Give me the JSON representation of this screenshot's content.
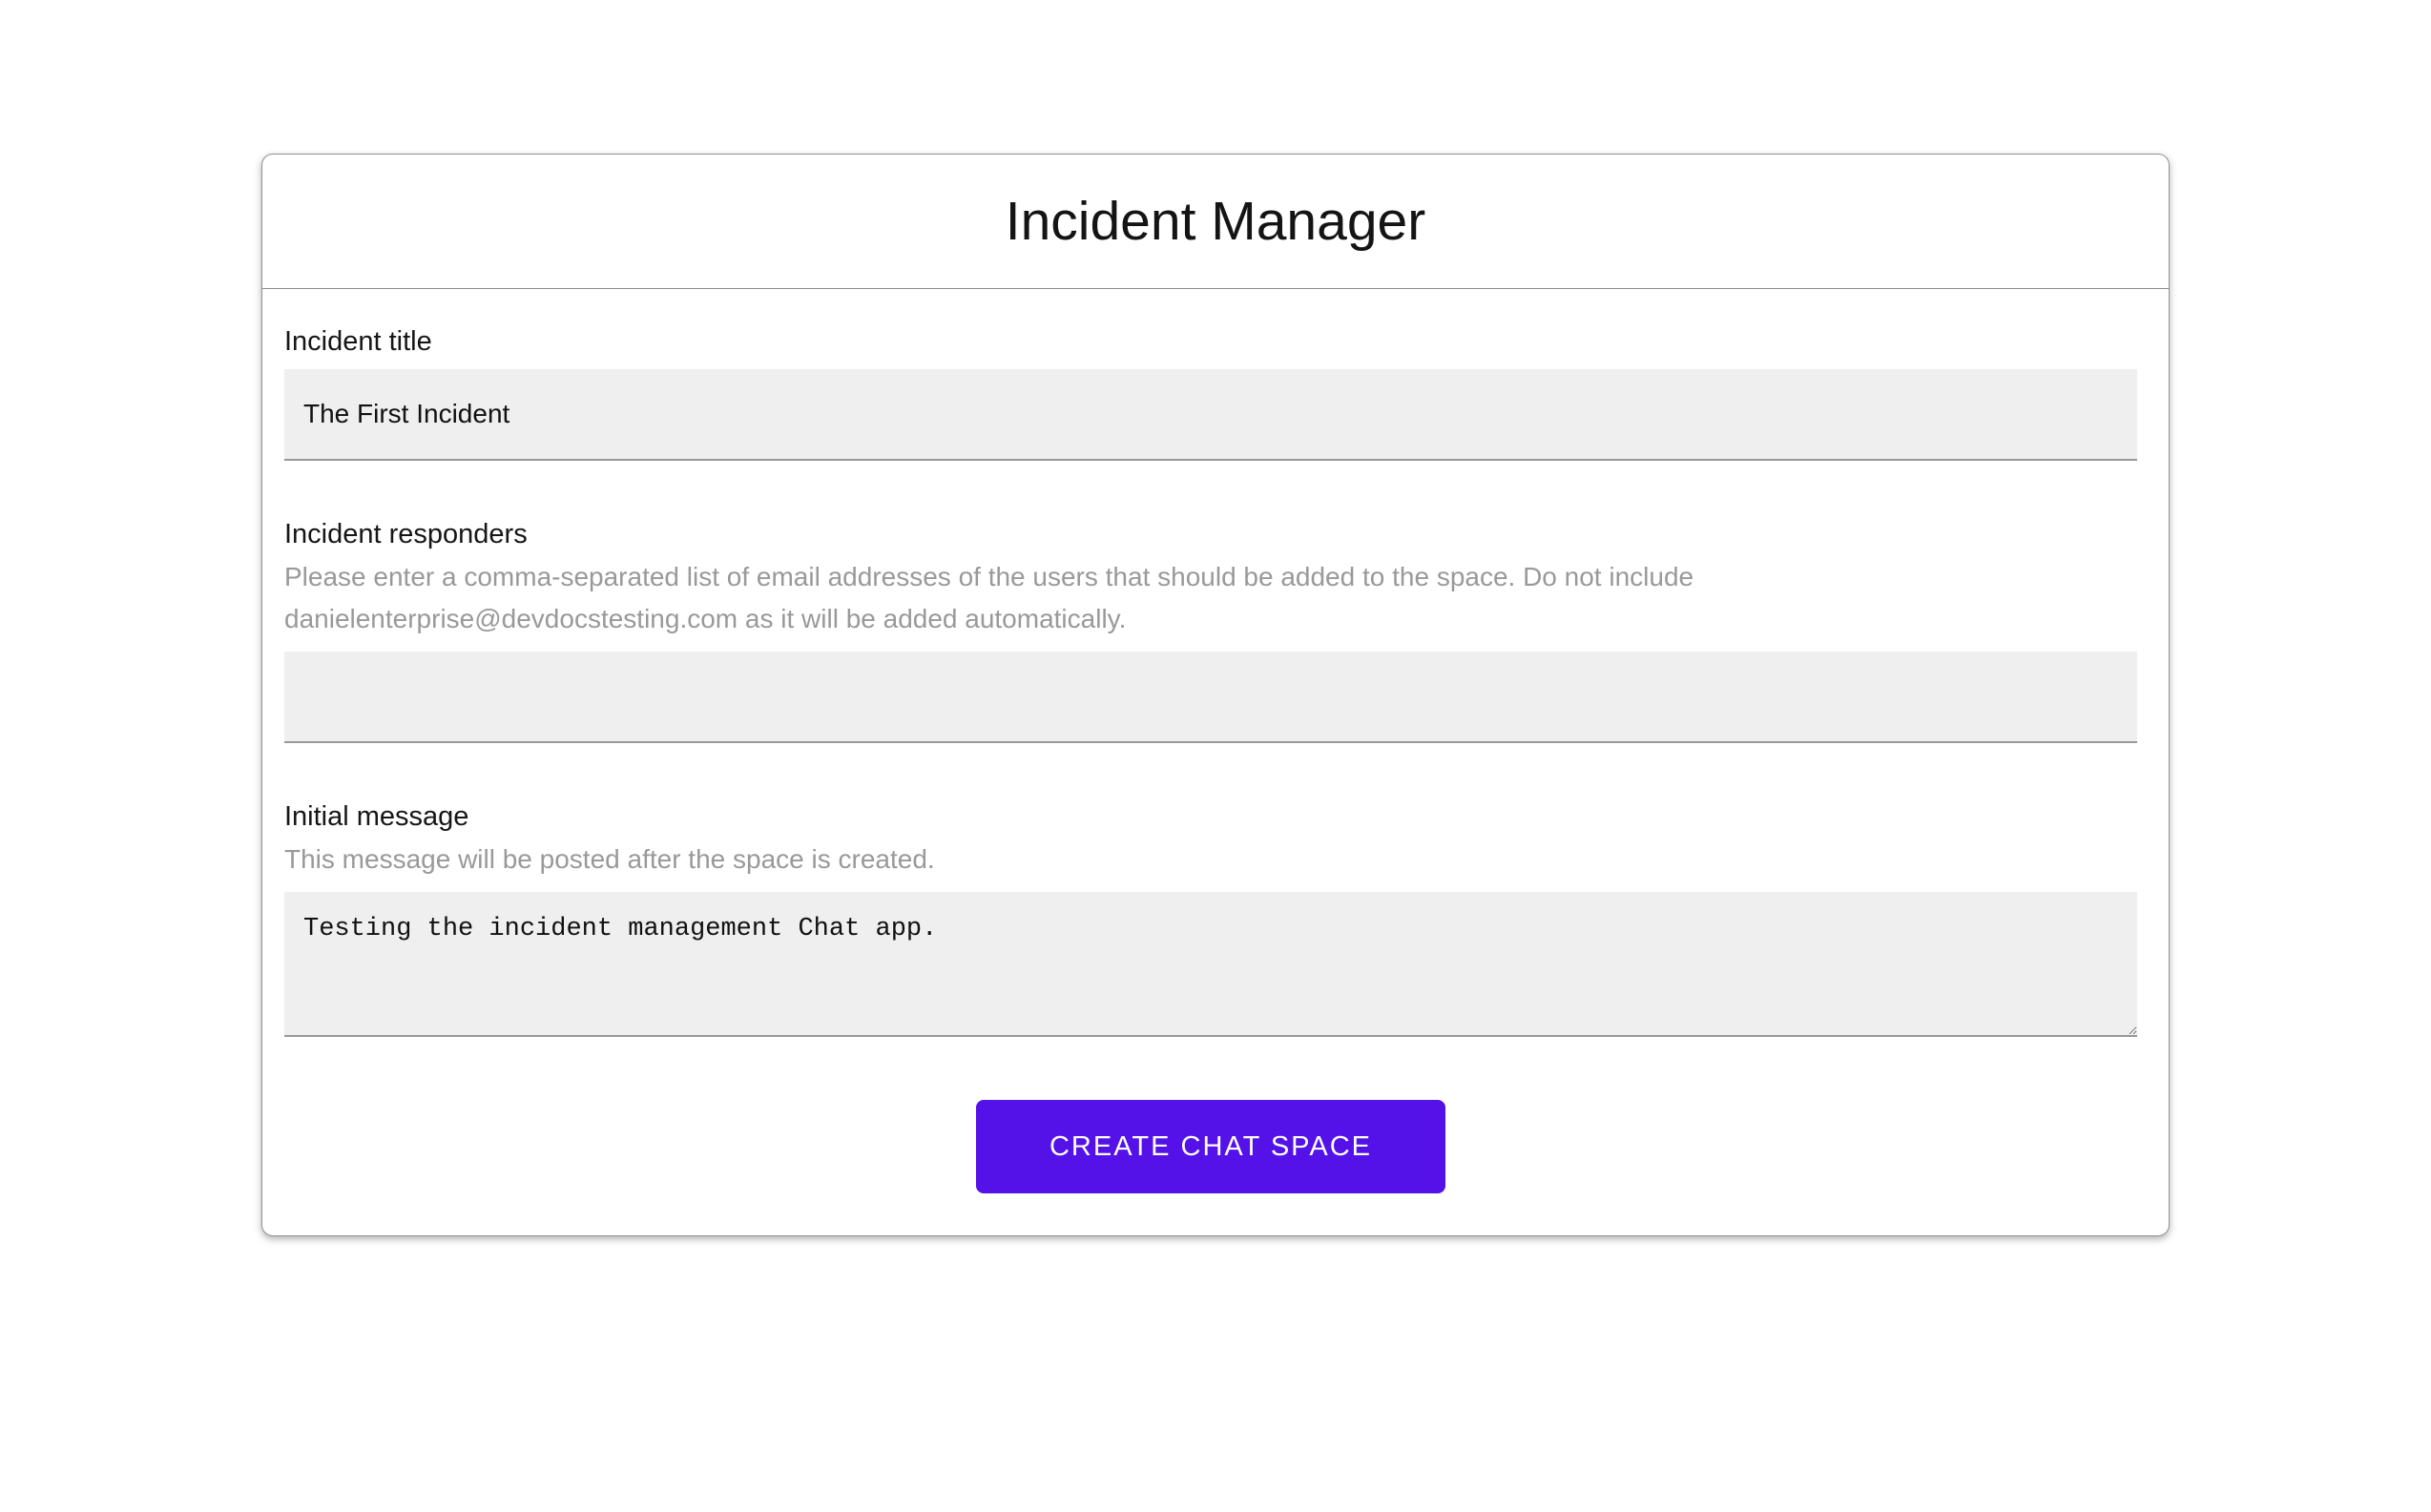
{
  "app": {
    "title": "Incident Manager"
  },
  "form": {
    "title_field": {
      "label": "Incident title",
      "value": "The First Incident"
    },
    "responders_field": {
      "label": "Incident responders",
      "helper": "Please enter a comma-separated list of email addresses of the users that should be added to the space. Do not include danielenterprise@devdocstesting.com as it will be added automatically.",
      "value": ""
    },
    "message_field": {
      "label": "Initial message",
      "helper": "This message will be posted after the space is created.",
      "value": "Testing the incident management Chat app."
    },
    "submit_label": "CREATE CHAT SPACE"
  },
  "colors": {
    "accent": "#5412e8",
    "input_background": "#efefef",
    "input_border": "#989898",
    "helper_text": "#999999",
    "card_border": "#919191"
  }
}
